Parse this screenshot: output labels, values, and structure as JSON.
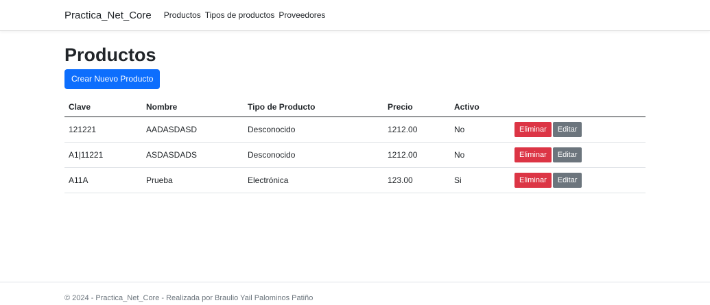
{
  "navbar": {
    "brand": "Practica_Net_Core",
    "links": [
      "Productos",
      "Tipos de productos",
      "Proveedores"
    ]
  },
  "page": {
    "title": "Productos",
    "create_button": "Crear Nuevo Producto"
  },
  "table": {
    "headers": [
      "Clave",
      "Nombre",
      "Tipo de Producto",
      "Precio",
      "Activo"
    ],
    "rows": [
      {
        "clave": "121221",
        "nombre": "AADASDASD",
        "tipo": "Desconocido",
        "precio": "1212.00",
        "activo": "No"
      },
      {
        "clave": "A1|11221",
        "nombre": "ASDASDADS",
        "tipo": "Desconocido",
        "precio": "1212.00",
        "activo": "No"
      },
      {
        "clave": "A11A",
        "nombre": "Prueba",
        "tipo": "Electrónica",
        "precio": "123.00",
        "activo": "Si"
      }
    ],
    "delete_label": "Eliminar",
    "edit_label": "Editar"
  },
  "footer": {
    "text": "© 2024 - Practica_Net_Core - Realizada por Braulio Yail Palominos Patiño"
  },
  "colors": {
    "primary": "#0d6efd",
    "danger": "#dc3545",
    "secondary": "#6c757d"
  }
}
